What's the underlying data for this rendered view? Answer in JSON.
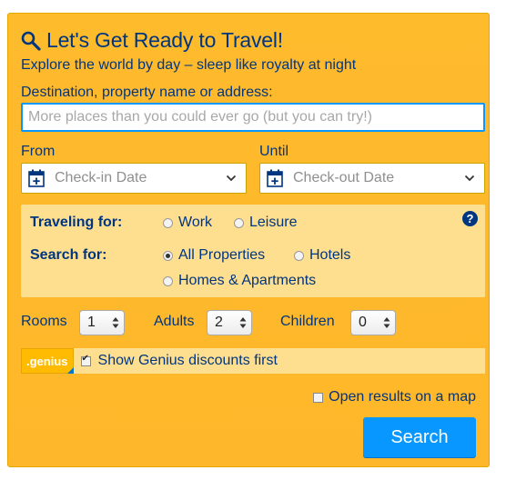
{
  "header": {
    "title": "Let's Get Ready to Travel!",
    "subtitle": "Explore the world by day – sleep like royalty at night"
  },
  "destination": {
    "label": "Destination, property name or address:",
    "placeholder": "More places than you could ever go (but you can try!)",
    "value": ""
  },
  "dates": {
    "from_label": "From",
    "until_label": "Until",
    "checkin_placeholder": "Check-in Date",
    "checkout_placeholder": "Check-out Date"
  },
  "traveling_for": {
    "label": "Traveling for:",
    "options": [
      "Work",
      "Leisure"
    ],
    "selected": null
  },
  "search_for": {
    "label": "Search for:",
    "options": [
      "All Properties",
      "Hotels",
      "Homes & Apartments"
    ],
    "selected": "All Properties"
  },
  "counts": {
    "rooms_label": "Rooms",
    "rooms_value": "1",
    "adults_label": "Adults",
    "adults_value": "2",
    "children_label": "Children",
    "children_value": "0"
  },
  "genius": {
    "badge": ".genius",
    "label": "Show Genius discounts first",
    "checked": true
  },
  "map": {
    "label": "Open results on a map",
    "checked": false
  },
  "search_button": {
    "label": "Search"
  },
  "colors": {
    "panel": "#feba02",
    "options_bg": "#fedf90",
    "text": "#003580",
    "accent": "#0896ff"
  },
  "icons": {
    "title_icon": "magnifier-icon",
    "date_icon": "calendar-plus-icon",
    "help_icon": "question-icon"
  }
}
